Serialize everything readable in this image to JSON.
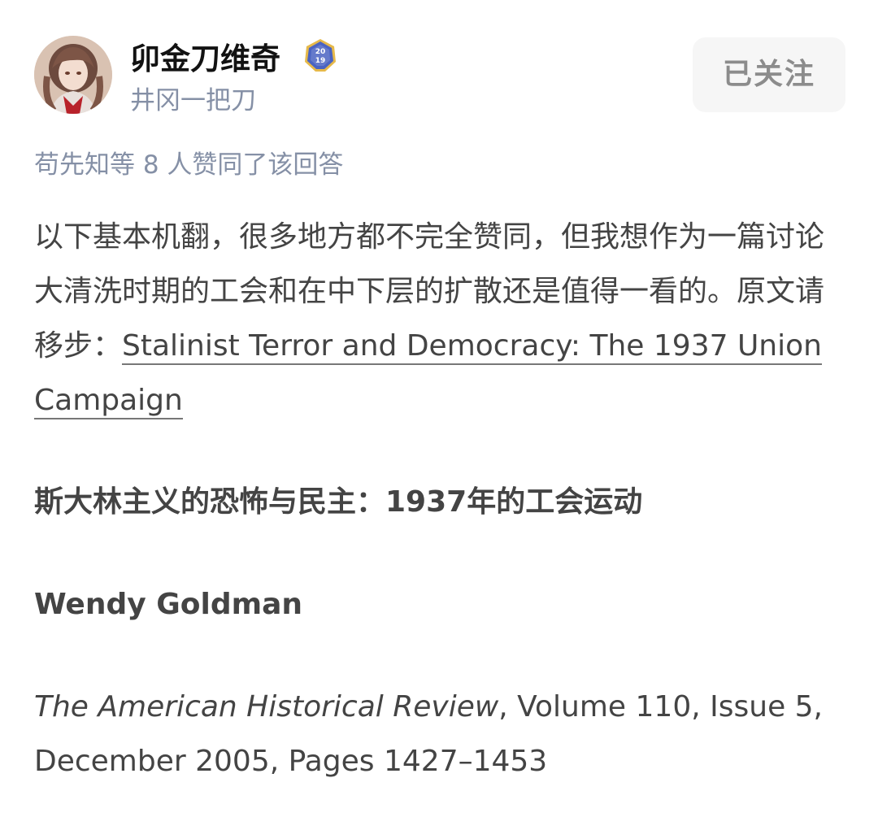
{
  "author": {
    "name": "卯金刀维奇",
    "bio": "井冈一把刀",
    "badge_year": "2019"
  },
  "follow_button": {
    "label": "已关注"
  },
  "upvote_line": "苟先知等 8 人赞同了该回答",
  "article": {
    "intro_text": "以下基本机翻，很多地方都不完全赞同，但我想作为一篇讨论大清洗时期的工会和在中下层的扩散还是值得一看的。原文请移步：",
    "source_link_text": "Stalinist Terror and Democracy: The 1937 Union Campaign",
    "chinese_title": "斯大林主义的恐怖与民主：1937年的工会运动",
    "author": "Wendy Goldman",
    "citation_journal": "The American Historical Review",
    "citation_details": ", Volume 110, Issue 5, December 2005, Pages 1427–1453"
  },
  "colors": {
    "name": "#121212",
    "meta": "#8590a6",
    "body_text": "#444444",
    "button_bg": "#f6f6f6",
    "button_text": "#8c8c8c",
    "badge_blue": "#4a63c2",
    "badge_gold": "#e6b94a"
  }
}
